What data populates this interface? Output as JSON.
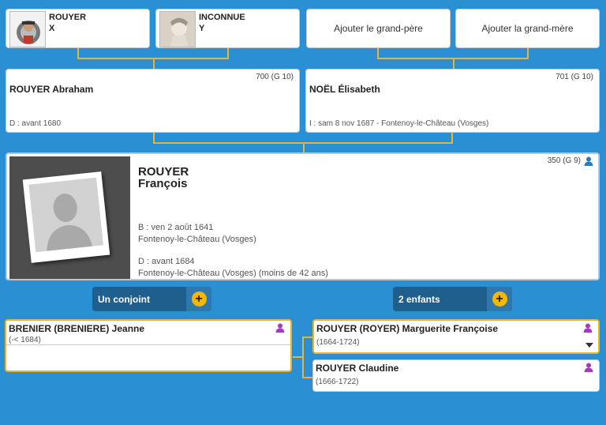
{
  "grandparents": [
    {
      "last": "ROUYER",
      "first": "X"
    },
    {
      "last": "INCONNUE",
      "first": "Y"
    }
  ],
  "add_grandfather": "Ajouter le grand-père",
  "add_grandmother": "Ajouter la grand-mère",
  "father": {
    "name": "ROUYER Abraham",
    "sosa": "700 (G 10)",
    "event": "D : avant 1680"
  },
  "mother": {
    "name": "NOËL Élisabeth",
    "sosa": "701 (G 10)",
    "event": "I : sam 8 nov 1687 - Fontenoy-le-Château (Vosges)"
  },
  "main": {
    "last": "ROUYER",
    "first": "François",
    "sosa": "350 (G 9)",
    "birth_date": "B : ven 2 août 1641",
    "birth_place": "Fontenoy-le-Château (Vosges)",
    "death_date": "D : avant 1684",
    "death_place": "Fontenoy-le-Château (Vosges) (moins de 42 ans)"
  },
  "spouse_button": "Un conjoint",
  "children_button": "2 enfants",
  "spouse": {
    "name": "BRENIER (BRENIERE) Jeanne",
    "dates": "(-< 1684)"
  },
  "children": [
    {
      "name": "ROUYER (ROYER) Marguerite Françoise",
      "dates": "(1664-1724)"
    },
    {
      "name": "ROUYER Claudine",
      "dates": "(1666-1722)"
    }
  ],
  "colors": {
    "background": "#2a8fd3",
    "connector": "#e5b53a",
    "highlight": "#f0b21e",
    "female_icon": "#a03cc0",
    "male_icon": "#2a7bc4"
  }
}
